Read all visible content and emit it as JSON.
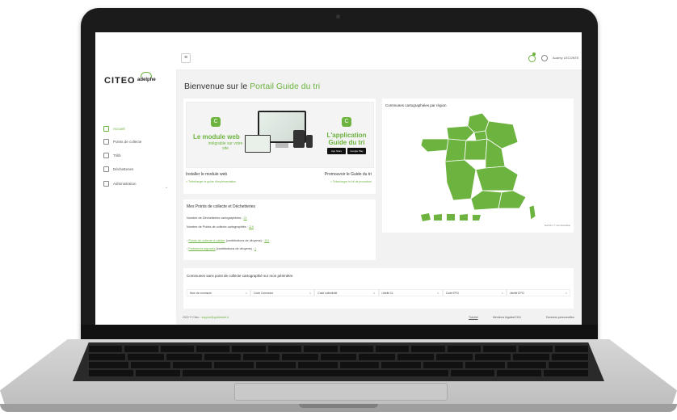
{
  "topbar": {
    "menu_icon": "hamburger-icon",
    "user_name": "Audrey LECONTE"
  },
  "brand": {
    "name": "CITEO",
    "partner": "adelphe"
  },
  "sidebar": {
    "items": [
      {
        "label": "Accueil",
        "icon": "home-icon",
        "active": true
      },
      {
        "label": "Points de collecte",
        "icon": "upload-icon",
        "active": false
      },
      {
        "label": "Trilib",
        "icon": "upload-icon",
        "active": false
      },
      {
        "label": "Déchetteries",
        "icon": "recycle-icon",
        "active": false
      },
      {
        "label": "Administration",
        "icon": "settings-icon",
        "active": false
      }
    ]
  },
  "page": {
    "title_prefix": "Bienvenue sur le",
    "title_highlight": "Portail Guide du tri"
  },
  "promo": {
    "banner_left_title": "Le module web",
    "banner_left_sub": "intégrable sur votre site",
    "banner_right_title": "L'application Guide du tri",
    "store_buttons": [
      "App Store",
      "Google Play"
    ],
    "left_label": "Installer le module web",
    "left_link": "> Télécharger le guide d'implémentation",
    "right_label": "Promouvoir le Guide du tri",
    "right_link": "> Télécharger le kit de promotion"
  },
  "points": {
    "title": "Mes Points de collecte et Déchetteries",
    "dechetteries_label": "Nombre de Déchetteries cartographiées :",
    "dechetteries_value": "21",
    "points_label": "Nombre de Points de collecte cartographiés :",
    "points_value": "119",
    "link1_label": "Points de collecte à valider",
    "link1_suffix": "(contributions de citoyens) :",
    "link1_value": "101",
    "link2_label": "Problèmes signalés",
    "link2_suffix": "(contributions de citoyens) :",
    "link2_value": "1"
  },
  "map": {
    "title": "Communes cartographiées par région",
    "credit": "MapTiler | © OpenStreetMap",
    "accent": "#6cb33f"
  },
  "table": {
    "title": "Communes sans point de collecte cartographié sur mon périmètre",
    "columns": [
      "Nom de commune",
      "Code Commune",
      "Code collectivité",
      "Libellé CL",
      "Code EPCI",
      "Libellé EPCI"
    ]
  },
  "footer": {
    "copyright": "2022 © Citeo ·",
    "email": "support@guidedutri.fr",
    "tutorial": "Tutoriel",
    "mentions": "Mentions légales/CGU",
    "donnees": "Données personnelles"
  },
  "colors": {
    "accent": "#6cb33f",
    "bezel": "#1b1b1b"
  }
}
